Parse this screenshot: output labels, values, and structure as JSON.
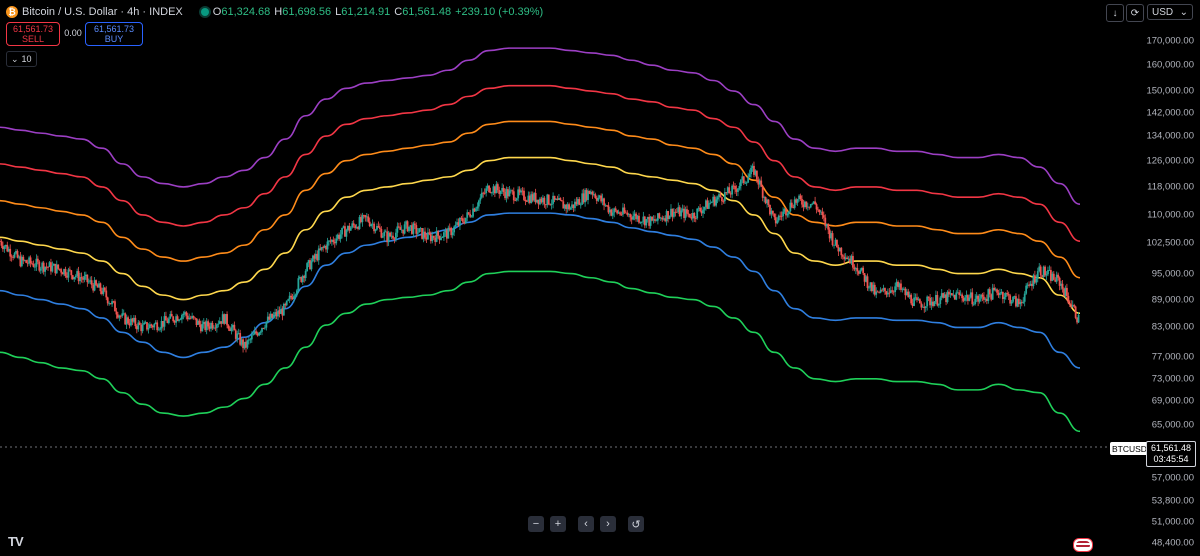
{
  "header": {
    "symbol_title": "Bitcoin / U.S. Dollar · 4h · INDEX",
    "coin_glyph": "₿",
    "open_key": "O",
    "open": "61,324.68",
    "high_key": "H",
    "high": "61,698.56",
    "low_key": "L",
    "low": "61,214.91",
    "close_key": "C",
    "close": "61,561.48",
    "change": "+239.10 (+0.39%)"
  },
  "trade": {
    "sell_price": "61,561.73",
    "sell_label": "SELL",
    "spread": "0.00",
    "buy_price": "61,561.73",
    "buy_label": "BUY"
  },
  "indicator": {
    "glyph": "⌄",
    "value": "10"
  },
  "toolbar": {
    "download_glyph": "↓",
    "snapshot_glyph": "⟳",
    "currency": "USD",
    "currency_caret": "⌄"
  },
  "nav": {
    "zoom_out": "−",
    "zoom_in": "+",
    "back": "‹",
    "forward": "›",
    "reset": "↺"
  },
  "logo": "TV",
  "price_label": {
    "symbol": "BTCUSD",
    "price": "61,561.48",
    "countdown": "03:45:54"
  },
  "colors": {
    "background": "#000000",
    "up": "#26a69a",
    "down": "#ef5350",
    "band_purple": "#9c3fc4",
    "band_red": "#f23645",
    "band_orange": "#ff8c1a",
    "band_yellow": "#ffd84d",
    "band_blue": "#2f7fe0",
    "band_green": "#1fd15a"
  },
  "chart_data": {
    "type": "line",
    "scale": "log",
    "ylim": [
      48400,
      180000
    ],
    "grid": false,
    "y_ticks": [
      "170,000.00",
      "160,000.00",
      "150,000.00",
      "142,000.00",
      "134,000.00",
      "126,000.00",
      "118,000.00",
      "110,000.00",
      "102,500.00",
      "95,000.00",
      "89,000.00",
      "83,000.00",
      "77,000.00",
      "73,000.00",
      "69,000.00",
      "65,000.00",
      "61,000.00",
      "57,000.00",
      "53,800.00",
      "51,000.00",
      "48,400.00"
    ],
    "y_tick_values": [
      170000,
      160000,
      150000,
      142000,
      134000,
      126000,
      118000,
      110000,
      102500,
      95000,
      89000,
      83000,
      77000,
      73000,
      69000,
      65000,
      61000,
      57000,
      53800,
      51000,
      48400
    ],
    "last_price": 61561.48,
    "x": [
      0,
      1,
      2,
      3,
      4,
      5,
      6,
      7,
      8,
      9,
      10,
      11,
      12,
      13,
      14,
      15,
      16,
      17,
      18,
      19,
      20,
      21,
      22,
      23,
      24,
      25,
      26,
      27,
      28,
      29,
      30,
      31,
      32,
      33,
      34,
      35,
      36,
      37,
      38,
      39,
      40,
      41,
      42,
      43,
      44,
      45,
      46,
      47,
      48,
      49,
      50,
      51,
      52,
      53
    ],
    "price": [
      103000,
      98000,
      97000,
      96000,
      94000,
      91000,
      85000,
      83000,
      84000,
      86000,
      83000,
      85000,
      79000,
      84000,
      87000,
      96000,
      102000,
      106000,
      109000,
      104000,
      107000,
      104000,
      105000,
      110000,
      118000,
      116000,
      115000,
      114000,
      112000,
      117000,
      111000,
      110000,
      108000,
      111000,
      110000,
      114000,
      117000,
      123000,
      108000,
      114000,
      113000,
      102000,
      97000,
      90000,
      92000,
      88000,
      89000,
      90000,
      89000,
      91000,
      88000,
      96000,
      93000,
      84000
    ],
    "band_series": [
      {
        "color": "band_purple",
        "values": [
          137000,
          136000,
          135000,
          134000,
          133000,
          130000,
          125000,
          121000,
          119000,
          118000,
          119000,
          121000,
          123000,
          127000,
          133000,
          141000,
          147000,
          151000,
          153000,
          154000,
          155000,
          156000,
          158000,
          162000,
          166000,
          167000,
          167000,
          167000,
          166000,
          165000,
          164000,
          162000,
          160000,
          158000,
          157000,
          154000,
          150000,
          145000,
          139000,
          133000,
          130000,
          129000,
          130000,
          130000,
          129000,
          129000,
          128000,
          127000,
          127000,
          128000,
          127000,
          124000,
          119000,
          113000
        ]
      },
      {
        "color": "band_red",
        "values": [
          125000,
          124000,
          123000,
          122000,
          121000,
          118000,
          114000,
          110000,
          108000,
          107000,
          108000,
          110000,
          112000,
          116000,
          121000,
          128000,
          134000,
          138000,
          140000,
          141000,
          142000,
          143000,
          145000,
          148000,
          151000,
          152000,
          152000,
          152000,
          151000,
          150000,
          149000,
          147000,
          146000,
          144000,
          143000,
          140000,
          137000,
          132000,
          126000,
          121000,
          118000,
          117000,
          118000,
          118000,
          117000,
          117000,
          116000,
          115000,
          115000,
          116000,
          115000,
          113000,
          108000,
          103000
        ]
      },
      {
        "color": "band_orange",
        "values": [
          114000,
          113000,
          112000,
          111000,
          110000,
          108000,
          104000,
          101000,
          99000,
          98000,
          99000,
          100000,
          102000,
          106000,
          110000,
          117000,
          122000,
          126000,
          128000,
          129000,
          130000,
          131000,
          132000,
          135000,
          138000,
          139000,
          139000,
          139000,
          138000,
          137000,
          136000,
          134000,
          133000,
          131000,
          130000,
          128000,
          125000,
          120000,
          115000,
          110000,
          108000,
          107000,
          108000,
          108000,
          107000,
          107000,
          106000,
          105000,
          105000,
          106000,
          105000,
          103000,
          99000,
          94000
        ]
      },
      {
        "color": "band_yellow",
        "values": [
          104000,
          103000,
          102000,
          101000,
          100000,
          98000,
          95000,
          92000,
          90000,
          89000,
          90000,
          91000,
          93000,
          96000,
          100000,
          106000,
          111000,
          115000,
          117000,
          118000,
          119000,
          120000,
          121000,
          123000,
          126000,
          127000,
          127000,
          127000,
          126000,
          125000,
          124000,
          122000,
          121000,
          120000,
          119000,
          117000,
          114000,
          110000,
          105000,
          100000,
          98000,
          97000,
          98000,
          98000,
          97000,
          97000,
          96000,
          95000,
          95000,
          96000,
          95000,
          94000,
          90000,
          86000
        ]
      },
      {
        "color": "band_blue",
        "values": [
          91000,
          90000,
          89000,
          88000,
          87000,
          85000,
          82000,
          80000,
          78000,
          77000,
          78000,
          79000,
          81000,
          84000,
          87000,
          92000,
          97000,
          100000,
          102000,
          103000,
          104000,
          105000,
          106000,
          108000,
          110000,
          110500,
          110500,
          110500,
          110000,
          109000,
          108000,
          106500,
          105500,
          104500,
          103500,
          101500,
          99000,
          95500,
          91000,
          87000,
          85000,
          84500,
          85000,
          85000,
          84500,
          84500,
          84000,
          83000,
          83000,
          84000,
          83000,
          82000,
          78000,
          75000
        ]
      },
      {
        "color": "band_green",
        "values": [
          78000,
          77000,
          76000,
          75000,
          74500,
          73000,
          70500,
          68500,
          67000,
          66500,
          67000,
          68000,
          69500,
          72000,
          75000,
          79000,
          83500,
          86000,
          88000,
          89000,
          89500,
          90000,
          91000,
          93000,
          95000,
          95500,
          95500,
          95500,
          95000,
          94000,
          93000,
          91500,
          90500,
          89500,
          89000,
          87500,
          85000,
          82000,
          78000,
          75000,
          73000,
          72500,
          73000,
          73000,
          72500,
          72500,
          72000,
          71000,
          71000,
          72000,
          71000,
          70500,
          67000,
          64000
        ]
      }
    ]
  }
}
